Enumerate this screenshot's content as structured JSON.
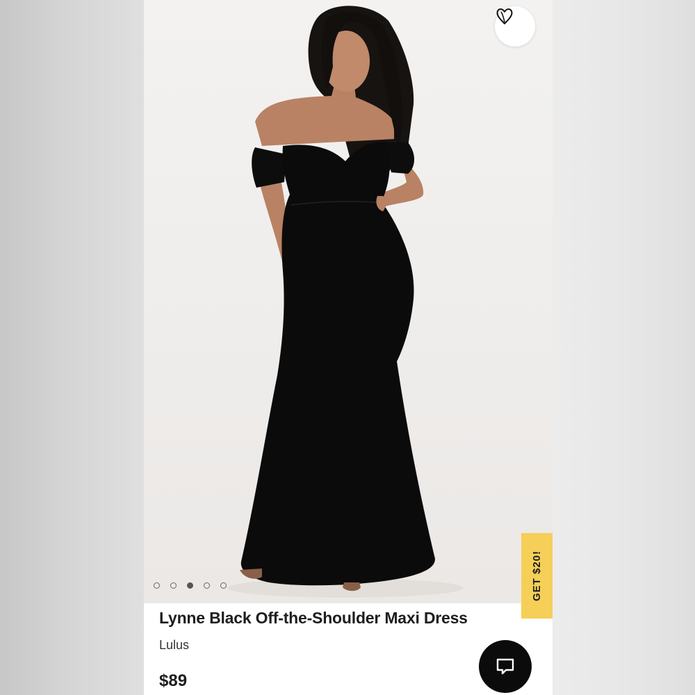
{
  "product": {
    "title": "Lynne Black Off-the-Shoulder Maxi Dress",
    "brand": "Lulus",
    "price": "$89"
  },
  "gallery": {
    "image_count": 5,
    "active_index": 3
  },
  "promo": {
    "label": "GET $20!",
    "color": "#f5cf58"
  },
  "icons": {
    "favorite": "heart-icon",
    "chat": "chat-bubble-icon"
  }
}
